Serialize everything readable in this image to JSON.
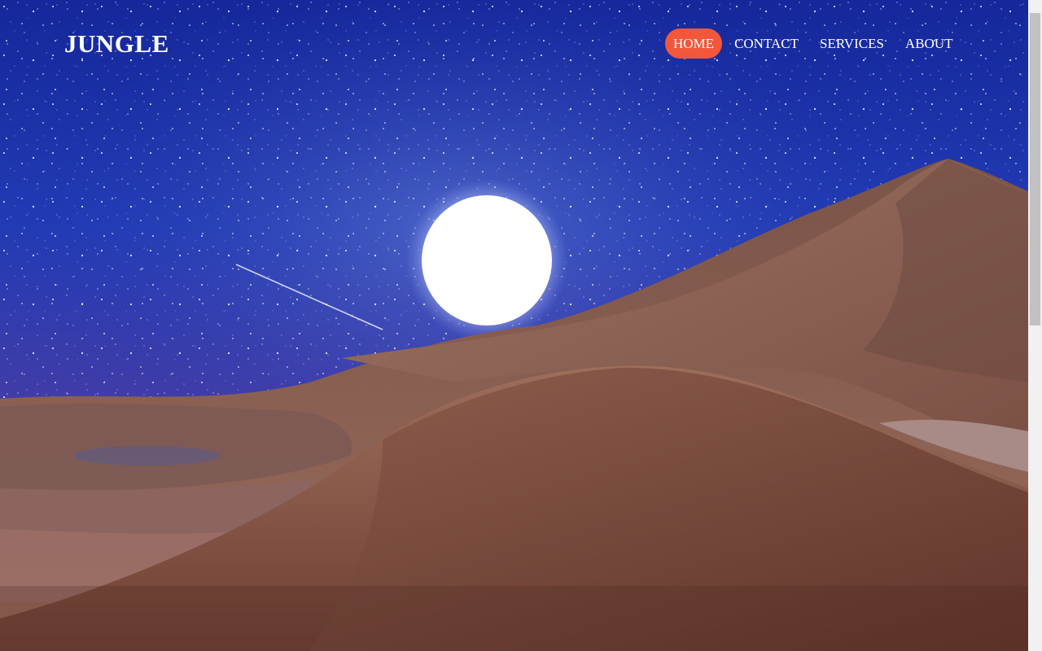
{
  "header": {
    "logo_text": "JUNGLE"
  },
  "nav": {
    "items": [
      {
        "label": "HOME",
        "active": true
      },
      {
        "label": "CONTACT",
        "active": false
      },
      {
        "label": "SERVICES",
        "active": false
      },
      {
        "label": "ABOUT",
        "active": false
      }
    ]
  },
  "theme": {
    "accent": "#f2573c",
    "sky": "#1a2f9e",
    "sand": "#8a5a4a"
  },
  "scene": {
    "description_icons": [
      "moon-icon",
      "shooting-star-icon",
      "sand-dune-icon",
      "stars-icon"
    ]
  }
}
